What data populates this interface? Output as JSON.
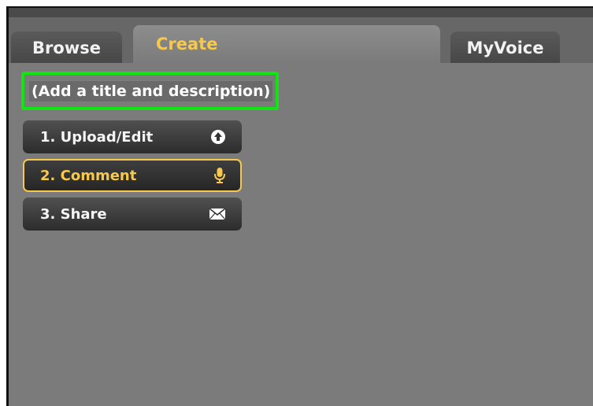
{
  "tabs": {
    "browse": "Browse",
    "create": "Create",
    "myvoice": "MyVoice"
  },
  "title_field": {
    "value": "(Add a title and description)"
  },
  "steps": [
    {
      "label": "1. Upload/Edit",
      "icon": "upload-arrow-icon"
    },
    {
      "label": "2. Comment",
      "icon": "microphone-icon",
      "selected": true
    },
    {
      "label": "3. Share",
      "icon": "envelope-icon"
    }
  ],
  "colors": {
    "accent": "#f7c84a",
    "highlight": "#12e312",
    "panel": "#7b7b7b"
  }
}
